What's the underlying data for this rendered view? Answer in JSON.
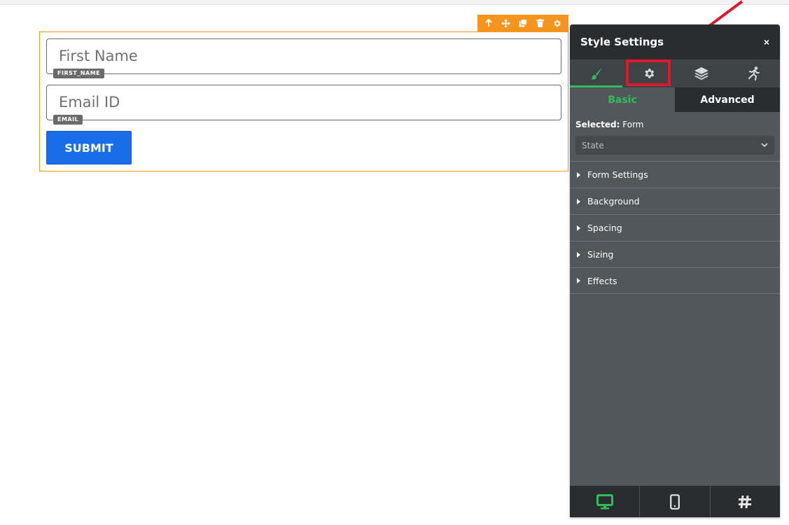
{
  "form": {
    "fields": [
      {
        "placeholder": "First Name",
        "tag": "FIRST_NAME"
      },
      {
        "placeholder": "Email ID",
        "tag": "EMAIL"
      }
    ],
    "submit_label": "SUBMIT",
    "toolbar_icons": [
      "arrow-up-icon",
      "move-icon",
      "duplicate-icon",
      "trash-icon",
      "gear-icon"
    ]
  },
  "panel": {
    "title": "Style Settings",
    "close_label": "×",
    "icon_tabs": [
      "paintbrush-icon",
      "gear-icon",
      "layers-icon",
      "animation-icon"
    ],
    "active_icon_tab": "paintbrush-icon",
    "highlighted_icon_tab": "gear-icon",
    "subtabs": {
      "basic": "Basic",
      "advanced": "Advanced"
    },
    "active_subtab": "Basic",
    "selected_label": "Selected:",
    "selected_value": "Form",
    "state_select": {
      "value": "State"
    },
    "sections": [
      "Form Settings",
      "Background",
      "Spacing",
      "Sizing",
      "Effects"
    ],
    "device_buttons": [
      "desktop-icon",
      "mobile-icon",
      "hash-icon"
    ],
    "active_device": "desktop-icon"
  },
  "colors": {
    "accent_green": "#2ebd59",
    "toolbar_orange": "#f7941d",
    "submit_blue": "#1a6de8",
    "annotation_red": "#e0182b",
    "panel_dark": "#2a2d2f",
    "panel_body": "#51575a"
  }
}
